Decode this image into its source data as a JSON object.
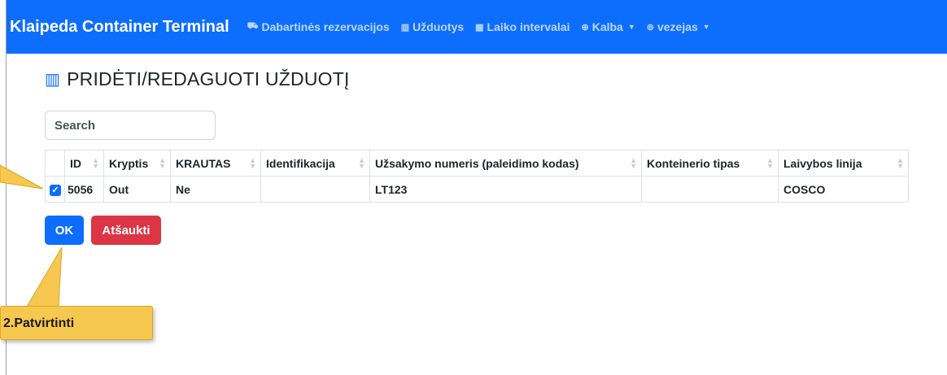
{
  "navbar": {
    "brand": "Klaipeda Container Terminal",
    "items": [
      {
        "icon": "truck-icon",
        "label": "Dabartinės rezervacijos"
      },
      {
        "icon": "container-icon",
        "label": "Užduotys"
      },
      {
        "icon": "calendar-icon",
        "label": "Laiko intervalai"
      },
      {
        "icon": "globe-icon",
        "label": "Kalba",
        "dropdown": true
      },
      {
        "icon": "user-icon",
        "label": "vezejas",
        "dropdown": true
      }
    ]
  },
  "page": {
    "title": "PRIDĖTI/REDAGUOTI UŽDUOTĮ",
    "title_icon": "container-icon"
  },
  "search": {
    "placeholder": "Search",
    "value": ""
  },
  "table": {
    "columns": [
      "",
      "ID",
      "Kryptis",
      "KRAUTAS",
      "Identifikacija",
      "Užsakymo numeris (paleidimo kodas)",
      "Konteinerio tipas",
      "Laivybos linija"
    ],
    "rows": [
      {
        "checked": true,
        "id": "5056",
        "kryptis": "Out",
        "krautas": "Ne",
        "identifikacija": "",
        "uzsakymo_numeris": "LT123",
        "konteinerio_tipas": "",
        "laivybos_linija": "COSCO"
      }
    ]
  },
  "buttons": {
    "ok": "OK",
    "cancel": "Atšaukti"
  },
  "callout": {
    "text": "2.Patvirtinti",
    "color": "#f7c84f"
  },
  "colors": {
    "primary": "#0d6efd",
    "danger": "#dc3545"
  }
}
